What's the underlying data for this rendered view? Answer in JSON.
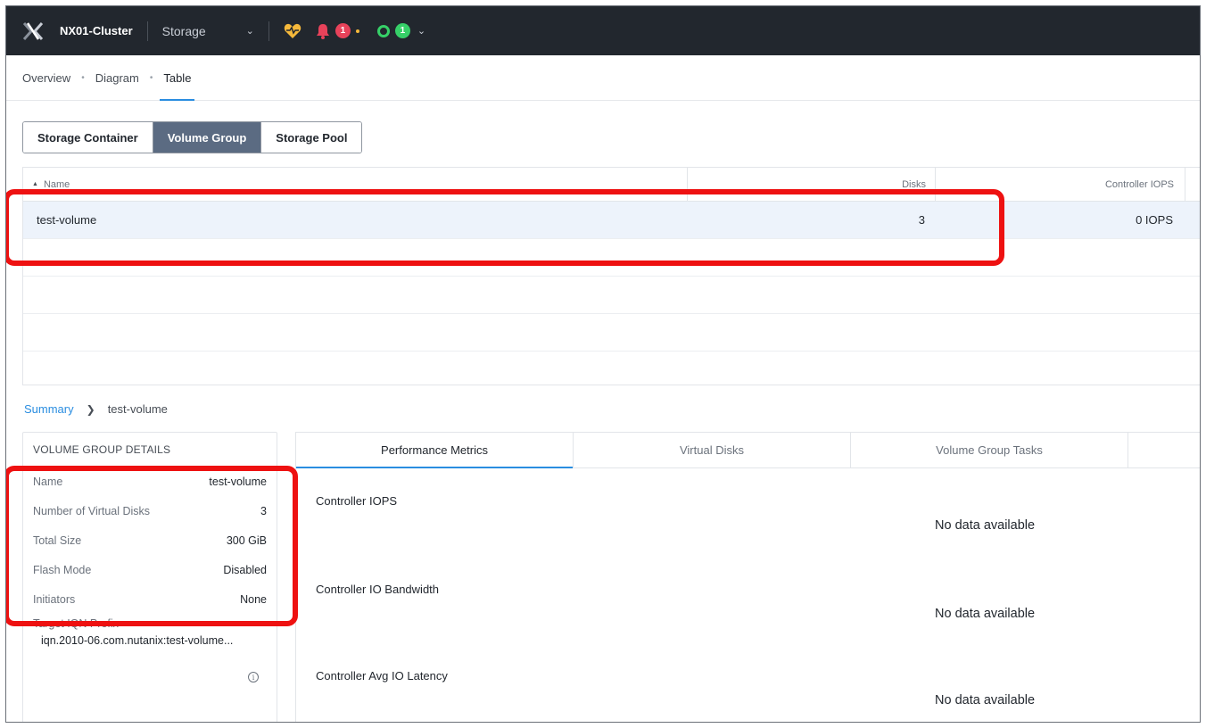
{
  "topbar": {
    "cluster_name": "NX01-Cluster",
    "app_name": "Storage",
    "alerts_count": "1",
    "tasks_count": "1",
    "colors": {
      "bg": "#22272e",
      "alert_red": "#e8425a",
      "ok_green": "#36d068",
      "health_yellow": "#f6b93b"
    }
  },
  "subnav": {
    "links": [
      "Overview",
      "Diagram",
      "Table"
    ],
    "active": "Table"
  },
  "entity_tabs": {
    "items": [
      "Storage Container",
      "Volume Group",
      "Storage Pool"
    ],
    "active": "Volume Group"
  },
  "table": {
    "columns": {
      "name": "Name",
      "disks": "Disks",
      "iops": "Controller IOPS"
    },
    "rows": [
      {
        "name": "test-volume",
        "disks": "3",
        "iops": "0 IOPS"
      }
    ]
  },
  "breadcrumb": {
    "root": "Summary",
    "current": "test-volume"
  },
  "details": {
    "title": "VOLUME GROUP DETAILS",
    "rows": [
      {
        "key": "Name",
        "value": "test-volume"
      },
      {
        "key": "Number of Virtual Disks",
        "value": "3"
      },
      {
        "key": "Total Size",
        "value": "300 GiB"
      },
      {
        "key": "Flash Mode",
        "value": "Disabled"
      },
      {
        "key": "Initiators",
        "value": "None"
      }
    ],
    "iqn_label": "Target IQN Prefix",
    "iqn_value": "iqn.2010-06.com.nutanix:test-volume...",
    "info_glyph": "i"
  },
  "metrics": {
    "tabs": [
      "Performance Metrics",
      "Virtual Disks",
      "Volume Group Tasks"
    ],
    "active": "Performance Metrics",
    "charts": [
      {
        "label": "Controller IOPS",
        "empty_text": "No data available"
      },
      {
        "label": "Controller IO Bandwidth",
        "empty_text": "No data available"
      },
      {
        "label": "Controller Avg IO Latency",
        "empty_text": "No data available"
      }
    ]
  }
}
